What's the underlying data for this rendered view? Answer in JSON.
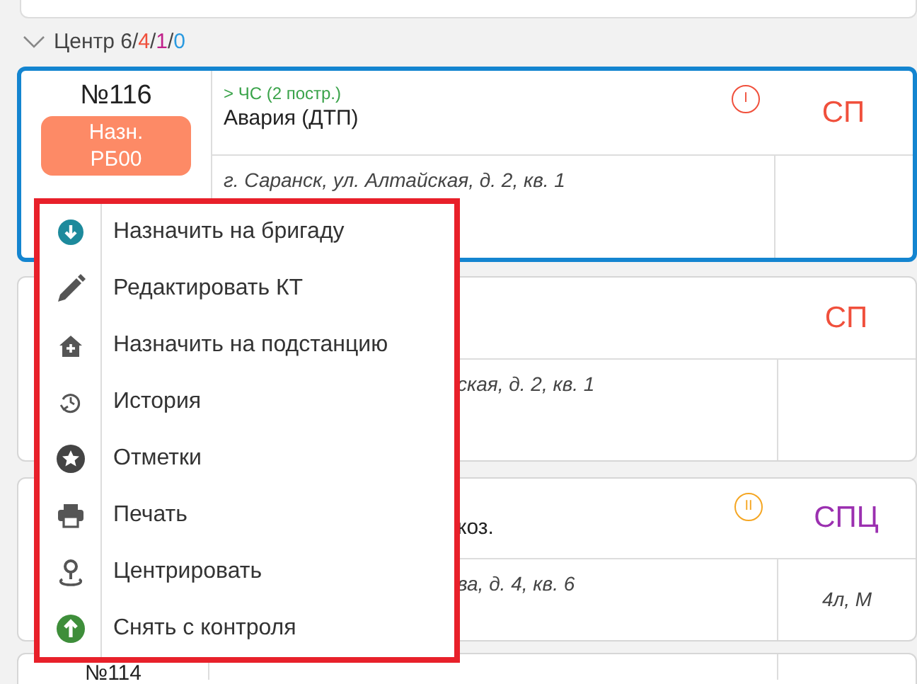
{
  "group": {
    "name": "Центр",
    "expanded": true,
    "separator": "/",
    "counts": [
      {
        "text": "6",
        "color": "#444444"
      },
      {
        "text": "4",
        "color": "#f0503c"
      },
      {
        "text": "1",
        "color": "#c0208a"
      },
      {
        "text": "0",
        "color": "#2a9ae0"
      }
    ]
  },
  "cards": [
    {
      "number": "№116",
      "selected": true,
      "badge": [
        "Назн.",
        "РБ00"
      ],
      "category": "> ЧС (2 постр.)",
      "title": "Авария (ДТП)",
      "priority": {
        "label": "I",
        "color": "#f0503c"
      },
      "team": {
        "text": "СП",
        "color": "#f0503c"
      },
      "address": "г. Саранск, ул. Алтайская, д. 2, кв. 1"
    },
    {
      "selected": false,
      "team": {
        "text": "СП",
        "color": "#f0503c"
      },
      "address": "ская, д. 2, кв. 1"
    },
    {
      "selected": false,
      "title": "коз.",
      "priority": {
        "label": "II",
        "color": "#f5a623"
      },
      "team": {
        "text": "СПЦ",
        "color": "#9b30b0"
      },
      "address": "ва, д. 4, кв. 6",
      "note": "4л, М"
    },
    {
      "number": "№114",
      "selected": false
    }
  ],
  "context_menu": {
    "items": [
      {
        "kind": "assign-team",
        "label": "Назначить на бригаду"
      },
      {
        "kind": "edit",
        "label": "Редактировать КТ"
      },
      {
        "kind": "assign-station",
        "label": "Назначить на подстанцию"
      },
      {
        "kind": "history",
        "label": "История"
      },
      {
        "kind": "marks",
        "label": "Отметки"
      },
      {
        "kind": "print",
        "label": "Печать"
      },
      {
        "kind": "center",
        "label": "Центрировать"
      },
      {
        "kind": "remove",
        "label": "Снять с контроля"
      }
    ]
  }
}
